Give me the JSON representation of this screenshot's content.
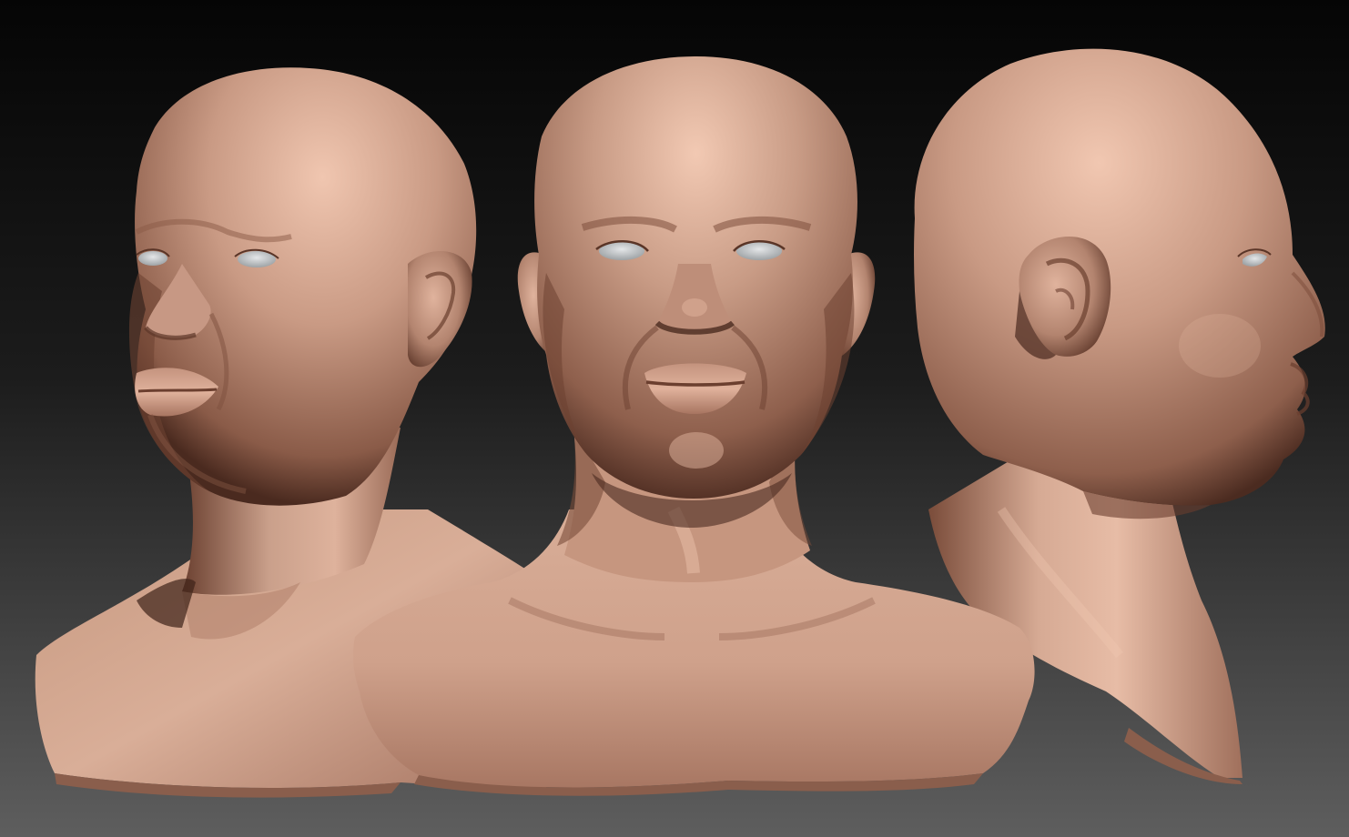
{
  "scene": {
    "views": [
      {
        "id": "three-quarter-left"
      },
      {
        "id": "front"
      },
      {
        "id": "profile-right"
      }
    ],
    "colors": {
      "background_top": "#050505",
      "background_bottom": "#5e5e5e",
      "skin_light": "#e6b9a3",
      "skin_mid": "#b98a76",
      "skin_dark": "#5a3527",
      "shadow": "#2a1510",
      "eye": "#c4c7c9"
    }
  }
}
